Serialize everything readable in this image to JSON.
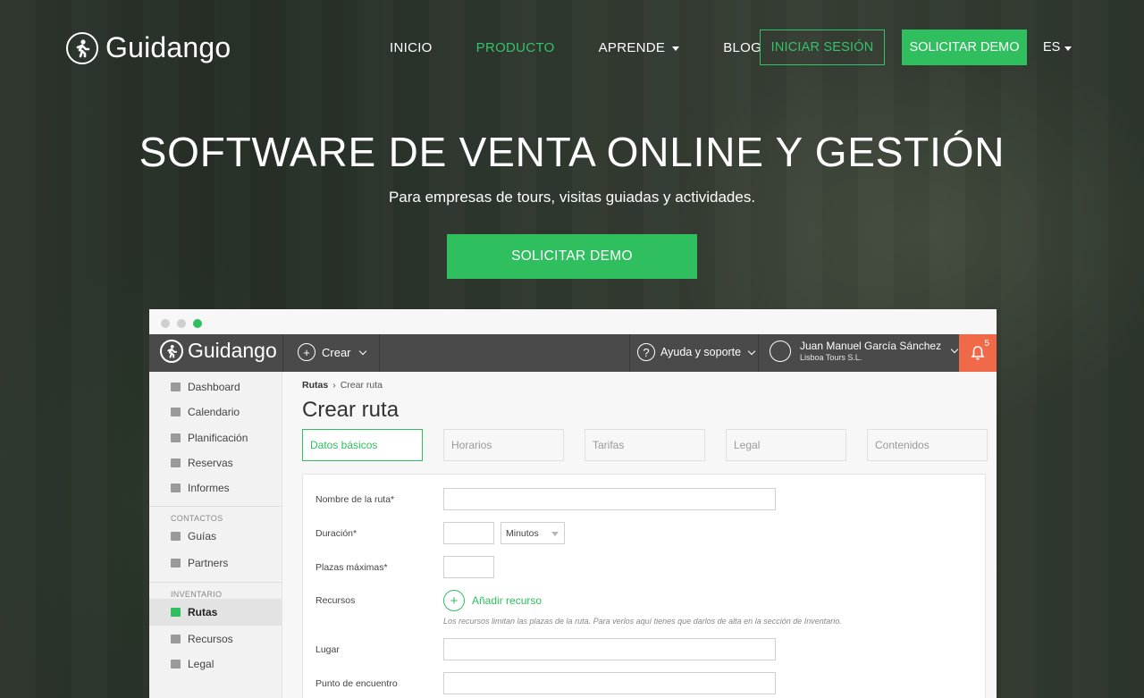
{
  "brand": {
    "name": "Guidango"
  },
  "nav": {
    "items": [
      {
        "label": "INICIO",
        "active": false,
        "has_caret": false
      },
      {
        "label": "PRODUCTO",
        "active": true,
        "has_caret": false
      },
      {
        "label": "APRENDE",
        "active": false,
        "has_caret": true
      },
      {
        "label": "BLOG",
        "active": false,
        "has_caret": false
      }
    ],
    "login_label": "INICIAR SESIÓN",
    "demo_label": "SOLICITAR DEMO",
    "lang_label": "ES"
  },
  "hero": {
    "title": "SOFTWARE DE VENTA ONLINE Y GESTIÓN",
    "subtitle": "Para empresas de tours, visitas guiadas y actividades.",
    "cta_label": "SOLICITAR DEMO"
  },
  "colors": {
    "accent": "#2fbf5e",
    "notification": "#f06a4a",
    "appbar": "#4a4a4a"
  },
  "app": {
    "brand": "Guidango",
    "create_label": "Crear",
    "help_label": "Ayuda y soporte",
    "user_name": "Juan Manuel García Sánchez",
    "user_org": "Lisboa Tours S.L.",
    "notification_count": "5",
    "sidebar": {
      "main_items": [
        {
          "label": "Dashboard",
          "icon": "home-icon"
        },
        {
          "label": "Calendario",
          "icon": "calendar-icon"
        },
        {
          "label": "Planificación",
          "icon": "edit-icon"
        },
        {
          "label": "Reservas",
          "icon": "cart-icon"
        },
        {
          "label": "Informes",
          "icon": "bar-chart-icon"
        }
      ],
      "contacts_heading": "CONTACTOS",
      "contacts_items": [
        {
          "label": "Guías",
          "icon": "group-icon"
        },
        {
          "label": "Partners",
          "icon": "briefcase-icon"
        }
      ],
      "inventory_heading": "INVENTARIO",
      "inventory_items": [
        {
          "label": "Rutas",
          "icon": "image-icon",
          "active": true
        },
        {
          "label": "Recursos",
          "icon": "wrench-icon"
        },
        {
          "label": "Legal",
          "icon": "bank-icon"
        }
      ]
    },
    "breadcrumb": {
      "parent": "Rutas",
      "current": "Crear ruta"
    },
    "page_title": "Crear ruta",
    "tabs": [
      "Datos básicos",
      "Horarios",
      "Tarifas",
      "Legal",
      "Contenidos"
    ],
    "form": {
      "route_name_label": "Nombre de la ruta*",
      "duration_label": "Duración*",
      "duration_unit": "Minutos",
      "max_seats_label": "Plazas máximas*",
      "resources_label": "Recursos",
      "add_resource_label": "Añadir recurso",
      "resources_hint": "Los recursos limitan las plazas de la ruta. Para verlos aquí tienes que darlos de alta en la sección de Inventario.",
      "place_label": "Lugar",
      "meeting_point_label": "Punto de encuentro"
    }
  }
}
